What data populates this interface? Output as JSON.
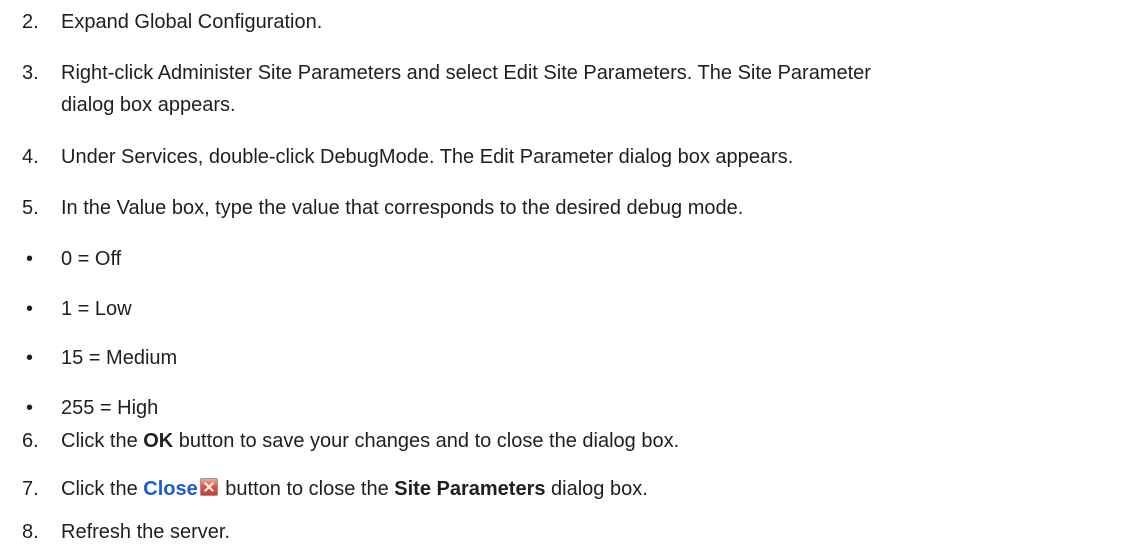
{
  "steps": [
    {
      "number": "2.",
      "text": "Expand Global Configuration."
    },
    {
      "number": "3.",
      "text_line1": "Right-click Administer Site Parameters and select Edit Site Parameters. The Site Parameter",
      "text_line2": "dialog box appears."
    },
    {
      "number": "4.",
      "text": "Under Services, double-click DebugMode. The Edit Parameter dialog box appears."
    },
    {
      "number": "5.",
      "text": "In the Value box, type the value that corresponds to the desired debug mode."
    },
    {
      "number": "6.",
      "pre": "Click the ",
      "bold": "OK",
      "post": " button to save your changes and to close the dialog box."
    },
    {
      "number": "7.",
      "pre": "Click the ",
      "link": "Close",
      "mid": " button to close the ",
      "bold": "Site Parameters",
      "post": " dialog box."
    },
    {
      "number": "8.",
      "text": "Refresh the server."
    }
  ],
  "bullets": [
    {
      "symbol": "•",
      "text": "0 = Off"
    },
    {
      "symbol": "•",
      "text": "1 = Low"
    },
    {
      "symbol": "•",
      "text": "15 = Medium"
    },
    {
      "symbol": "•",
      "text": "255 = High"
    }
  ],
  "icons": {
    "close_icon": "close-icon",
    "close_icon_color": "#e4553d",
    "link_color": "#1e5ad6"
  }
}
